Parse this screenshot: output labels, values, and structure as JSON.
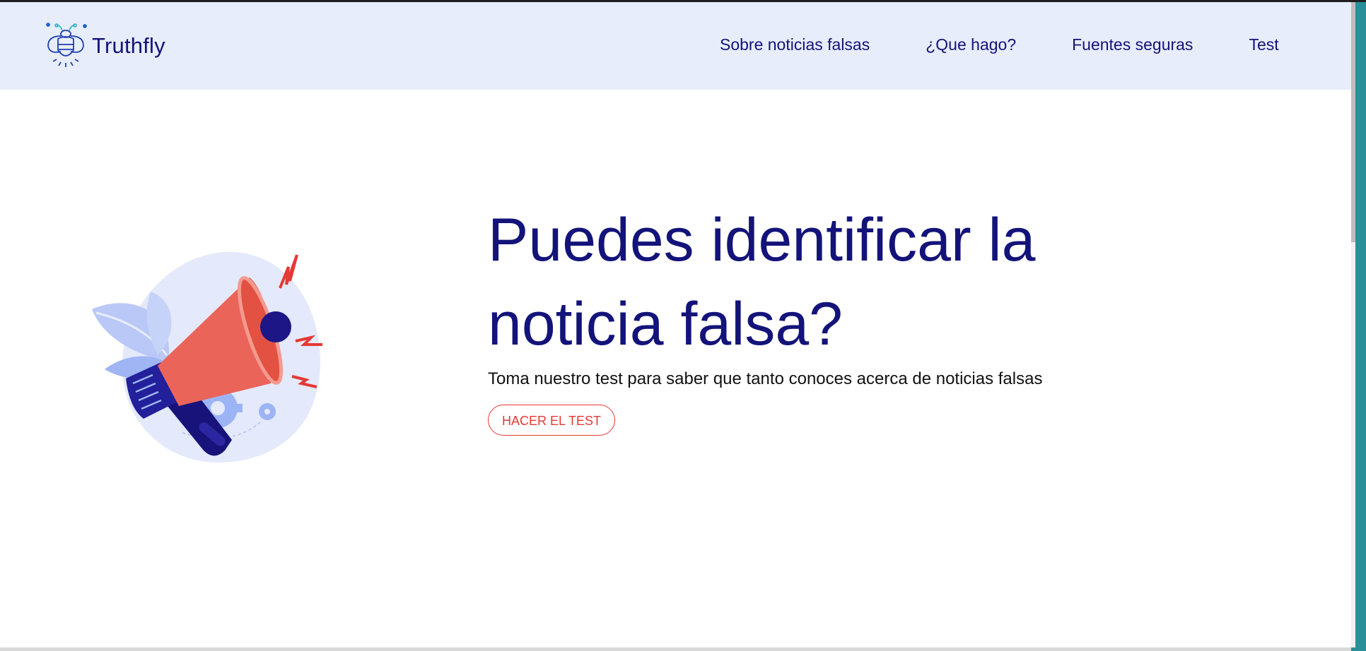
{
  "brand": {
    "name": "Truthfly",
    "logo_icon": "firefly-bee-icon"
  },
  "nav": {
    "items": [
      {
        "label": "Sobre noticias falsas"
      },
      {
        "label": "¿Que hago?"
      },
      {
        "label": "Fuentes seguras"
      },
      {
        "label": "Test"
      }
    ]
  },
  "hero": {
    "title": "Puedes identificar la noticia falsa?",
    "subtitle": "Toma nuestro test para saber que tanto conoces acerca de noticias falsas",
    "cta_label": "HACER EL TEST",
    "illustration_icon": "megaphone-icon"
  },
  "colors": {
    "nav_background": "#e8edfb",
    "primary_text": "#13137a",
    "accent_red": "#e53935",
    "megaphone_red": "#eb6459",
    "illustration_blob": "#e4e9fb"
  }
}
